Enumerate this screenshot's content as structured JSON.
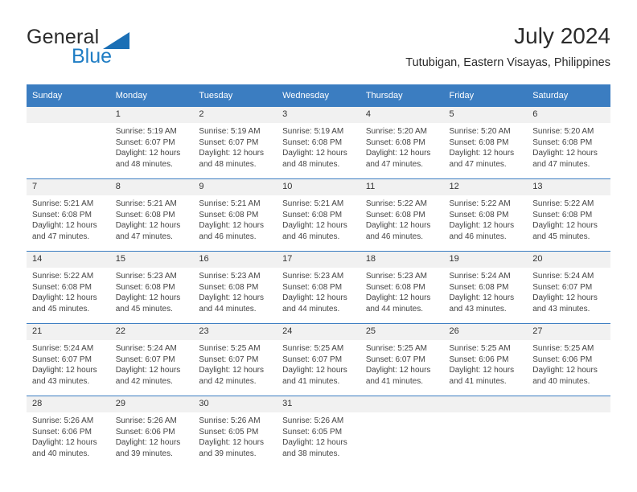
{
  "brand": {
    "name_part1": "General",
    "name_part2": "Blue",
    "logo_color": "#1b6fb5",
    "accent_color": "#3b7dc1"
  },
  "header": {
    "title": "July 2024",
    "subtitle": "Tutubigan, Eastern Visayas, Philippines"
  },
  "weekday_headers": [
    "Sunday",
    "Monday",
    "Tuesday",
    "Wednesday",
    "Thursday",
    "Friday",
    "Saturday"
  ],
  "weeks": [
    {
      "days": [
        {
          "num": "",
          "sunrise": "",
          "sunset": "",
          "daylight": ""
        },
        {
          "num": "1",
          "sunrise": "Sunrise: 5:19 AM",
          "sunset": "Sunset: 6:07 PM",
          "daylight": "Daylight: 12 hours and 48 minutes."
        },
        {
          "num": "2",
          "sunrise": "Sunrise: 5:19 AM",
          "sunset": "Sunset: 6:07 PM",
          "daylight": "Daylight: 12 hours and 48 minutes."
        },
        {
          "num": "3",
          "sunrise": "Sunrise: 5:19 AM",
          "sunset": "Sunset: 6:08 PM",
          "daylight": "Daylight: 12 hours and 48 minutes."
        },
        {
          "num": "4",
          "sunrise": "Sunrise: 5:20 AM",
          "sunset": "Sunset: 6:08 PM",
          "daylight": "Daylight: 12 hours and 47 minutes."
        },
        {
          "num": "5",
          "sunrise": "Sunrise: 5:20 AM",
          "sunset": "Sunset: 6:08 PM",
          "daylight": "Daylight: 12 hours and 47 minutes."
        },
        {
          "num": "6",
          "sunrise": "Sunrise: 5:20 AM",
          "sunset": "Sunset: 6:08 PM",
          "daylight": "Daylight: 12 hours and 47 minutes."
        }
      ]
    },
    {
      "days": [
        {
          "num": "7",
          "sunrise": "Sunrise: 5:21 AM",
          "sunset": "Sunset: 6:08 PM",
          "daylight": "Daylight: 12 hours and 47 minutes."
        },
        {
          "num": "8",
          "sunrise": "Sunrise: 5:21 AM",
          "sunset": "Sunset: 6:08 PM",
          "daylight": "Daylight: 12 hours and 47 minutes."
        },
        {
          "num": "9",
          "sunrise": "Sunrise: 5:21 AM",
          "sunset": "Sunset: 6:08 PM",
          "daylight": "Daylight: 12 hours and 46 minutes."
        },
        {
          "num": "10",
          "sunrise": "Sunrise: 5:21 AM",
          "sunset": "Sunset: 6:08 PM",
          "daylight": "Daylight: 12 hours and 46 minutes."
        },
        {
          "num": "11",
          "sunrise": "Sunrise: 5:22 AM",
          "sunset": "Sunset: 6:08 PM",
          "daylight": "Daylight: 12 hours and 46 minutes."
        },
        {
          "num": "12",
          "sunrise": "Sunrise: 5:22 AM",
          "sunset": "Sunset: 6:08 PM",
          "daylight": "Daylight: 12 hours and 46 minutes."
        },
        {
          "num": "13",
          "sunrise": "Sunrise: 5:22 AM",
          "sunset": "Sunset: 6:08 PM",
          "daylight": "Daylight: 12 hours and 45 minutes."
        }
      ]
    },
    {
      "days": [
        {
          "num": "14",
          "sunrise": "Sunrise: 5:22 AM",
          "sunset": "Sunset: 6:08 PM",
          "daylight": "Daylight: 12 hours and 45 minutes."
        },
        {
          "num": "15",
          "sunrise": "Sunrise: 5:23 AM",
          "sunset": "Sunset: 6:08 PM",
          "daylight": "Daylight: 12 hours and 45 minutes."
        },
        {
          "num": "16",
          "sunrise": "Sunrise: 5:23 AM",
          "sunset": "Sunset: 6:08 PM",
          "daylight": "Daylight: 12 hours and 44 minutes."
        },
        {
          "num": "17",
          "sunrise": "Sunrise: 5:23 AM",
          "sunset": "Sunset: 6:08 PM",
          "daylight": "Daylight: 12 hours and 44 minutes."
        },
        {
          "num": "18",
          "sunrise": "Sunrise: 5:23 AM",
          "sunset": "Sunset: 6:08 PM",
          "daylight": "Daylight: 12 hours and 44 minutes."
        },
        {
          "num": "19",
          "sunrise": "Sunrise: 5:24 AM",
          "sunset": "Sunset: 6:08 PM",
          "daylight": "Daylight: 12 hours and 43 minutes."
        },
        {
          "num": "20",
          "sunrise": "Sunrise: 5:24 AM",
          "sunset": "Sunset: 6:07 PM",
          "daylight": "Daylight: 12 hours and 43 minutes."
        }
      ]
    },
    {
      "days": [
        {
          "num": "21",
          "sunrise": "Sunrise: 5:24 AM",
          "sunset": "Sunset: 6:07 PM",
          "daylight": "Daylight: 12 hours and 43 minutes."
        },
        {
          "num": "22",
          "sunrise": "Sunrise: 5:24 AM",
          "sunset": "Sunset: 6:07 PM",
          "daylight": "Daylight: 12 hours and 42 minutes."
        },
        {
          "num": "23",
          "sunrise": "Sunrise: 5:25 AM",
          "sunset": "Sunset: 6:07 PM",
          "daylight": "Daylight: 12 hours and 42 minutes."
        },
        {
          "num": "24",
          "sunrise": "Sunrise: 5:25 AM",
          "sunset": "Sunset: 6:07 PM",
          "daylight": "Daylight: 12 hours and 41 minutes."
        },
        {
          "num": "25",
          "sunrise": "Sunrise: 5:25 AM",
          "sunset": "Sunset: 6:07 PM",
          "daylight": "Daylight: 12 hours and 41 minutes."
        },
        {
          "num": "26",
          "sunrise": "Sunrise: 5:25 AM",
          "sunset": "Sunset: 6:06 PM",
          "daylight": "Daylight: 12 hours and 41 minutes."
        },
        {
          "num": "27",
          "sunrise": "Sunrise: 5:25 AM",
          "sunset": "Sunset: 6:06 PM",
          "daylight": "Daylight: 12 hours and 40 minutes."
        }
      ]
    },
    {
      "days": [
        {
          "num": "28",
          "sunrise": "Sunrise: 5:26 AM",
          "sunset": "Sunset: 6:06 PM",
          "daylight": "Daylight: 12 hours and 40 minutes."
        },
        {
          "num": "29",
          "sunrise": "Sunrise: 5:26 AM",
          "sunset": "Sunset: 6:06 PM",
          "daylight": "Daylight: 12 hours and 39 minutes."
        },
        {
          "num": "30",
          "sunrise": "Sunrise: 5:26 AM",
          "sunset": "Sunset: 6:05 PM",
          "daylight": "Daylight: 12 hours and 39 minutes."
        },
        {
          "num": "31",
          "sunrise": "Sunrise: 5:26 AM",
          "sunset": "Sunset: 6:05 PM",
          "daylight": "Daylight: 12 hours and 38 minutes."
        },
        {
          "num": "",
          "sunrise": "",
          "sunset": "",
          "daylight": ""
        },
        {
          "num": "",
          "sunrise": "",
          "sunset": "",
          "daylight": ""
        },
        {
          "num": "",
          "sunrise": "",
          "sunset": "",
          "daylight": ""
        }
      ]
    }
  ]
}
